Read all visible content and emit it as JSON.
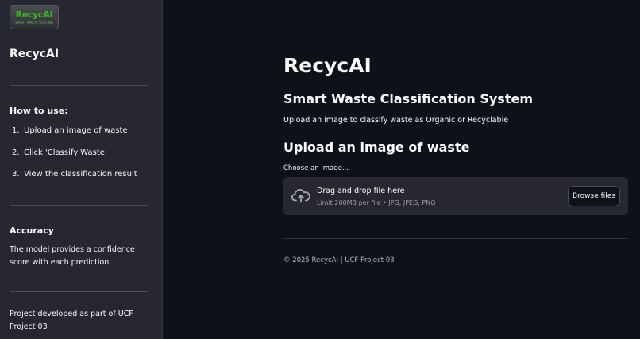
{
  "sidebar": {
    "logo_text": "RecycAI",
    "logo_subtext": "SMART WASTE SORTING",
    "title": "RecycAI",
    "how_to_use": {
      "heading": "How to use:",
      "steps": [
        {
          "num": "1.",
          "text": "Upload an image of waste"
        },
        {
          "num": "2.",
          "text": "Click 'Classify Waste'"
        },
        {
          "num": "3.",
          "text": "View the classification result"
        }
      ]
    },
    "accuracy": {
      "heading": "Accuracy",
      "text": "The model provides a confidence score with each prediction."
    },
    "project_note": "Project developed as part of UCF Project 03"
  },
  "main": {
    "title": "RecycAI",
    "subtitle": "Smart Waste Classification System",
    "description": "Upload an image to classify waste as Organic or Recyclable",
    "upload_heading": "Upload an image of waste",
    "uploader": {
      "label": "Choose an image...",
      "drag_text": "Drag and drop file here",
      "limit_text": "Limit 200MB per file • JPG, JPEG, PNG",
      "browse_label": "Browse files",
      "icon": "cloud-upload-icon"
    },
    "footer": "© 2025 RecycAI | UCF Project 03"
  },
  "colors": {
    "background": "#0e1117",
    "sidebar_bg": "#262730",
    "text": "#fafafa",
    "muted_text": "#9a9ca4",
    "logo_green": "#3fb52e"
  }
}
